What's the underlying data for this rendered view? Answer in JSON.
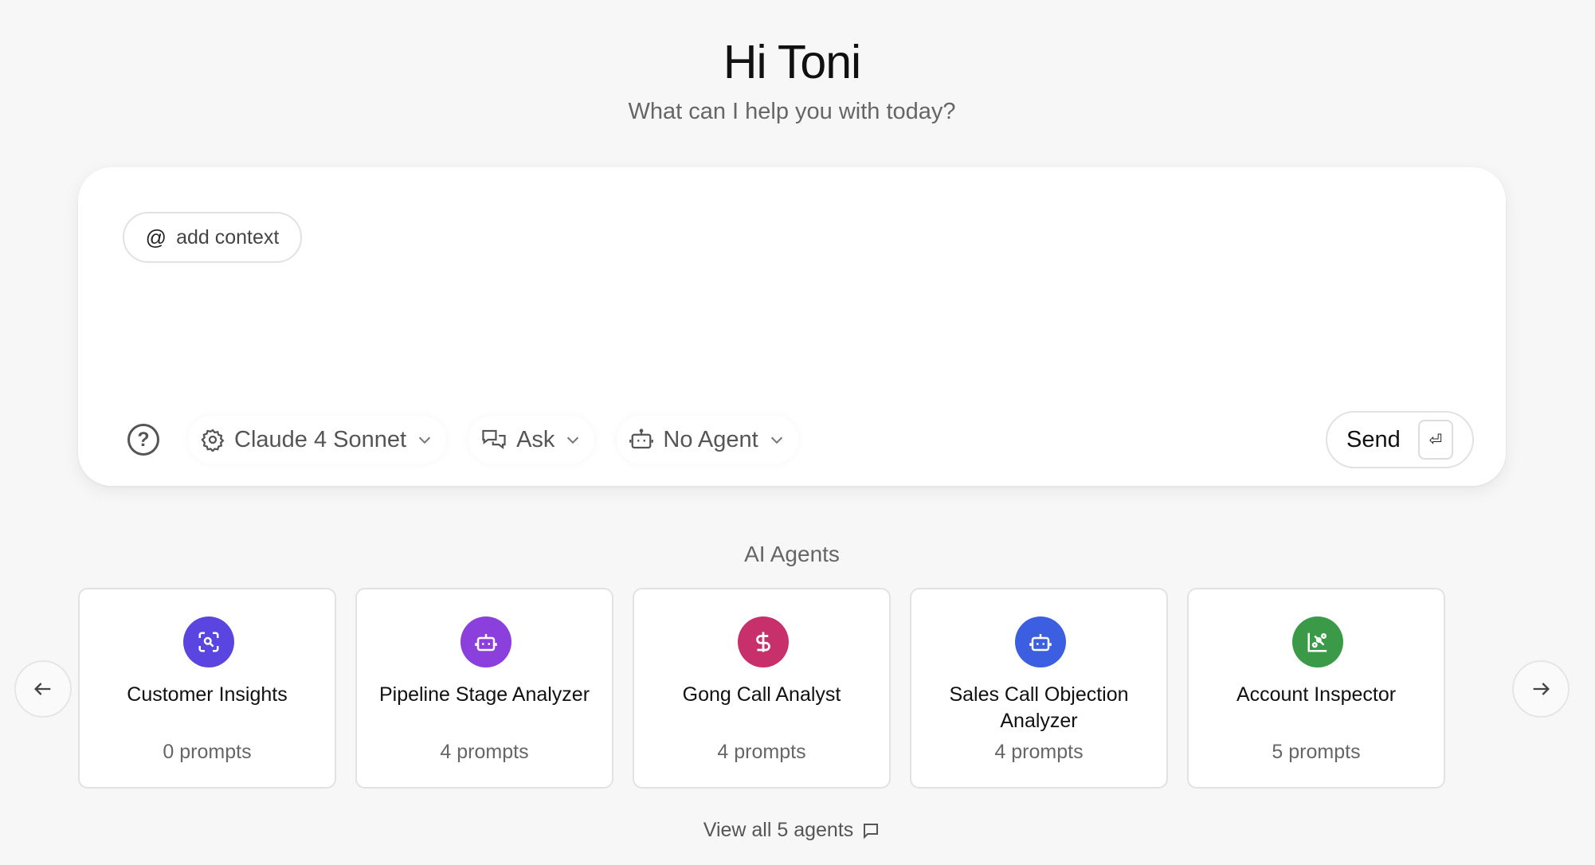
{
  "greeting": "Hi Toni",
  "subtitle": "What can I help you with today?",
  "composer": {
    "add_context_label": "add context",
    "model_label": "Claude 4 Sonnet",
    "mode_label": "Ask",
    "agent_label": "No Agent",
    "send_label": "Send",
    "send_key": "⏎"
  },
  "agents_section": {
    "title": "AI Agents",
    "view_all_label": "View all 5 agents",
    "cards": [
      {
        "name": "Customer Insights",
        "prompts": "0 prompts",
        "icon": "search-scan-icon",
        "color": "#5b45e0"
      },
      {
        "name": "Pipeline Stage Analyzer",
        "prompts": "4 prompts",
        "icon": "robot-icon",
        "color": "#8b3fdc"
      },
      {
        "name": "Gong Call Analyst",
        "prompts": "4 prompts",
        "icon": "dollar-icon",
        "color": "#c7306a"
      },
      {
        "name": "Sales Call Objection Analyzer",
        "prompts": "4 prompts",
        "icon": "robot-icon",
        "color": "#3b5fe0"
      },
      {
        "name": "Account Inspector",
        "prompts": "5 prompts",
        "icon": "chart-icon",
        "color": "#3a9a48"
      }
    ]
  }
}
